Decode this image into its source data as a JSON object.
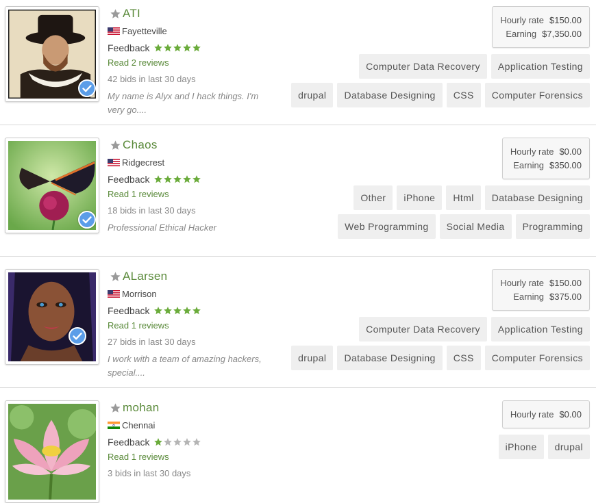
{
  "freelancers": [
    {
      "name": "ATI",
      "location": "Fayetteville",
      "feedback_label": "Feedback",
      "rating": 5,
      "reviews": "Read 2 reviews",
      "bids": "42 bids in last 30 days",
      "description": "My name is Alyx and I hack things. I'm very go....",
      "rate_label": "Hourly rate",
      "rate": "$150.00",
      "earning_label": "Earning",
      "earning": "$7,350.00",
      "tags_row1": [
        "Computer Data Recovery",
        "Application Testing"
      ],
      "tags_row2": [
        "drupal",
        "Database Designing",
        "CSS",
        "Computer Forensics"
      ],
      "flag": "us-flag-icon",
      "verified": true
    },
    {
      "name": "Chaos",
      "location": "Ridgecrest",
      "feedback_label": "Feedback",
      "rating": 5,
      "reviews": "Read 1 reviews",
      "bids": "18 bids in last 30 days",
      "description": "Professional Ethical Hacker",
      "rate_label": "Hourly rate",
      "rate": "$0.00",
      "earning_label": "Earning",
      "earning": "$350.00",
      "tags_row1": [
        "Other",
        "iPhone",
        "Html",
        "Database Designing"
      ],
      "tags_row2": [
        "Web Programming",
        "Social Media",
        "Programming"
      ],
      "flag": "us-flag-icon",
      "verified": true
    },
    {
      "name": "ALarsen",
      "location": "Morrison",
      "feedback_label": "Feedback",
      "rating": 5,
      "reviews": "Read 1 reviews",
      "bids": "27 bids in last 30 days",
      "description": "I work with a team of amazing hackers, special....",
      "rate_label": "Hourly rate",
      "rate": "$150.00",
      "earning_label": "Earning",
      "earning": "$375.00",
      "tags_row1": [
        "Computer Data Recovery",
        "Application Testing"
      ],
      "tags_row2": [
        "drupal",
        "Database Designing",
        "CSS",
        "Computer Forensics"
      ],
      "flag": "us-flag-icon",
      "verified": true
    },
    {
      "name": "mohan",
      "location": "Chennai",
      "feedback_label": "Feedback",
      "rating": 1,
      "reviews": "Read 1 reviews",
      "bids": "3 bids in last 30 days",
      "rate_label": "Hourly rate",
      "rate": "$0.00",
      "tags_row1": [
        "iPhone",
        "drupal"
      ],
      "flag": "in-flag-icon",
      "verified": false
    }
  ],
  "colors": {
    "accent_green": "#5a8a3a",
    "star_green": "#6aab3a",
    "star_grey": "#b5b5b5",
    "verified_blue": "#5b9de8"
  }
}
